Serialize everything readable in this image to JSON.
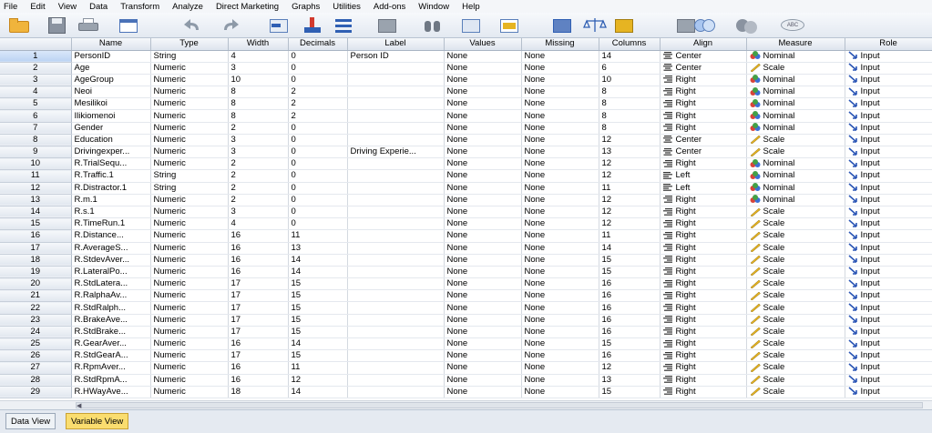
{
  "menu": [
    "File",
    "Edit",
    "View",
    "Data",
    "Transform",
    "Analyze",
    "Direct Marketing",
    "Graphs",
    "Utilities",
    "Add-ons",
    "Window",
    "Help"
  ],
  "columns": [
    "Name",
    "Type",
    "Width",
    "Decimals",
    "Label",
    "Values",
    "Missing",
    "Columns",
    "Align",
    "Measure",
    "Role"
  ],
  "rows": [
    [
      "1",
      "PersonID",
      "String",
      "4",
      "0",
      "Person ID",
      "None",
      "None",
      "14",
      "Center",
      "Nominal",
      "Input"
    ],
    [
      "2",
      "Age",
      "Numeric",
      "3",
      "0",
      "",
      "None",
      "None",
      "6",
      "Center",
      "Scale",
      "Input"
    ],
    [
      "3",
      "AgeGroup",
      "Numeric",
      "10",
      "0",
      "",
      "None",
      "None",
      "10",
      "Right",
      "Nominal",
      "Input"
    ],
    [
      "4",
      "Neoi",
      "Numeric",
      "8",
      "2",
      "",
      "None",
      "None",
      "8",
      "Right",
      "Nominal",
      "Input"
    ],
    [
      "5",
      "Mesilikoi",
      "Numeric",
      "8",
      "2",
      "",
      "None",
      "None",
      "8",
      "Right",
      "Nominal",
      "Input"
    ],
    [
      "6",
      "Ilikiomenoi",
      "Numeric",
      "8",
      "2",
      "",
      "None",
      "None",
      "8",
      "Right",
      "Nominal",
      "Input"
    ],
    [
      "7",
      "Gender",
      "Numeric",
      "2",
      "0",
      "",
      "None",
      "None",
      "8",
      "Right",
      "Nominal",
      "Input"
    ],
    [
      "8",
      "Education",
      "Numeric",
      "3",
      "0",
      "",
      "None",
      "None",
      "12",
      "Center",
      "Scale",
      "Input"
    ],
    [
      "9",
      "Drivingexper...",
      "Numeric",
      "3",
      "0",
      "Driving Experie...",
      "None",
      "None",
      "13",
      "Center",
      "Scale",
      "Input"
    ],
    [
      "10",
      "R.TrialSequ...",
      "Numeric",
      "2",
      "0",
      "",
      "None",
      "None",
      "12",
      "Right",
      "Nominal",
      "Input"
    ],
    [
      "11",
      "R.Traffic.1",
      "String",
      "2",
      "0",
      "",
      "None",
      "None",
      "12",
      "Left",
      "Nominal",
      "Input"
    ],
    [
      "12",
      "R.Distractor.1",
      "String",
      "2",
      "0",
      "",
      "None",
      "None",
      "11",
      "Left",
      "Nominal",
      "Input"
    ],
    [
      "13",
      "R.m.1",
      "Numeric",
      "2",
      "0",
      "",
      "None",
      "None",
      "12",
      "Right",
      "Nominal",
      "Input"
    ],
    [
      "14",
      "R.s.1",
      "Numeric",
      "3",
      "0",
      "",
      "None",
      "None",
      "12",
      "Right",
      "Scale",
      "Input"
    ],
    [
      "15",
      "R.TimeRun.1",
      "Numeric",
      "4",
      "0",
      "",
      "None",
      "None",
      "12",
      "Right",
      "Scale",
      "Input"
    ],
    [
      "16",
      "R.Distance...",
      "Numeric",
      "16",
      "11",
      "",
      "None",
      "None",
      "11",
      "Right",
      "Scale",
      "Input"
    ],
    [
      "17",
      "R.AverageS...",
      "Numeric",
      "16",
      "13",
      "",
      "None",
      "None",
      "14",
      "Right",
      "Scale",
      "Input"
    ],
    [
      "18",
      "R.StdevAver...",
      "Numeric",
      "16",
      "14",
      "",
      "None",
      "None",
      "15",
      "Right",
      "Scale",
      "Input"
    ],
    [
      "19",
      "R.LateralPo...",
      "Numeric",
      "16",
      "14",
      "",
      "None",
      "None",
      "15",
      "Right",
      "Scale",
      "Input"
    ],
    [
      "20",
      "R.StdLatera...",
      "Numeric",
      "17",
      "15",
      "",
      "None",
      "None",
      "16",
      "Right",
      "Scale",
      "Input"
    ],
    [
      "21",
      "R.RalphaAv...",
      "Numeric",
      "17",
      "15",
      "",
      "None",
      "None",
      "16",
      "Right",
      "Scale",
      "Input"
    ],
    [
      "22",
      "R.StdRalph...",
      "Numeric",
      "17",
      "15",
      "",
      "None",
      "None",
      "16",
      "Right",
      "Scale",
      "Input"
    ],
    [
      "23",
      "R.BrakeAve...",
      "Numeric",
      "17",
      "15",
      "",
      "None",
      "None",
      "16",
      "Right",
      "Scale",
      "Input"
    ],
    [
      "24",
      "R.StdBrake...",
      "Numeric",
      "17",
      "15",
      "",
      "None",
      "None",
      "16",
      "Right",
      "Scale",
      "Input"
    ],
    [
      "25",
      "R.GearAver...",
      "Numeric",
      "16",
      "14",
      "",
      "None",
      "None",
      "15",
      "Right",
      "Scale",
      "Input"
    ],
    [
      "26",
      "R.StdGearA...",
      "Numeric",
      "17",
      "15",
      "",
      "None",
      "None",
      "16",
      "Right",
      "Scale",
      "Input"
    ],
    [
      "27",
      "R.RpmAver...",
      "Numeric",
      "16",
      "11",
      "",
      "None",
      "None",
      "12",
      "Right",
      "Scale",
      "Input"
    ],
    [
      "28",
      "R.StdRpmA...",
      "Numeric",
      "16",
      "12",
      "",
      "None",
      "None",
      "13",
      "Right",
      "Scale",
      "Input"
    ],
    [
      "29",
      "R.HWayAve...",
      "Numeric",
      "18",
      "14",
      "",
      "None",
      "None",
      "15",
      "Right",
      "Scale",
      "Input"
    ]
  ],
  "tabs": [
    "Data View",
    "Variable View"
  ],
  "active_tab": "Variable View",
  "toolbar_icons": [
    "open-folder-icon",
    "save-icon",
    "print-icon",
    "dialog-recall-icon",
    "undo-icon",
    "redo-icon",
    "goto-case-icon",
    "goto-variable-icon",
    "variables-icon",
    "find-icon",
    "insert-cases-icon",
    "insert-variable-icon",
    "split-file-icon",
    "weight-cases-icon",
    "select-cases-icon",
    "value-labels-icon",
    "use-sets-icon",
    "show-all-variables-icon",
    "spell-check-icon"
  ],
  "colors": {
    "nominal_red": "#d8443a",
    "nominal_blue": "#3b6fd6",
    "nominal_green": "#43a047",
    "scale_pencil": "#e6b422",
    "role_arrow": "#2a55b5",
    "active_tab": "#fadd6f",
    "row_header": "#e1e7ef"
  }
}
